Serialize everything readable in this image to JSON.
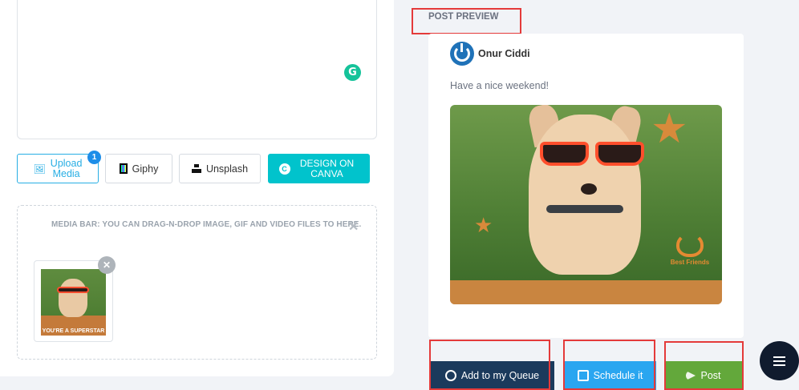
{
  "composer": {
    "grammarly_icon": "grammarly-icon",
    "tools": {
      "upload_label": "Upload\nMedia",
      "upload_badge": "1",
      "giphy_label": "Giphy",
      "unsplash_label": "Unsplash",
      "canva_label": "DESIGN ON CANVA"
    },
    "media_bar": {
      "hint": "MEDIA BAR: YOU CAN DRAG-N-DROP IMAGE, GIF AND VIDEO FILES TO HERE.",
      "close_glyph": "✕",
      "remove_glyph": "✕"
    }
  },
  "preview": {
    "title": "POST PREVIEW",
    "author": "Onur Ciddi",
    "text": "Have a nice weekend!",
    "image_logo_text": "Best Friends"
  },
  "actions": {
    "queue_label": "Add to my Queue",
    "schedule_label": "Schedule it",
    "post_label": "Post"
  },
  "colors": {
    "accent_blue": "#27aee4",
    "canva": "#01c3cc",
    "queue": "#1b3a5c",
    "schedule": "#2aa6f0",
    "post": "#63a83b",
    "highlight": "#e43a3a"
  }
}
